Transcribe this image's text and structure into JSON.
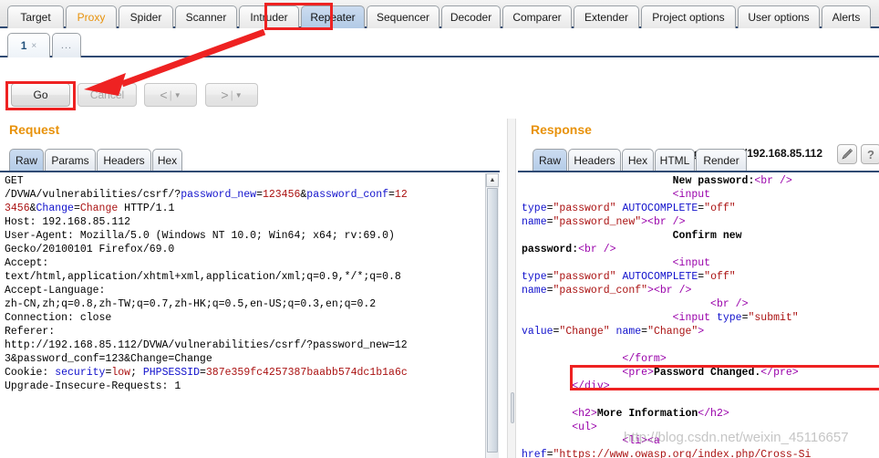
{
  "main_tabs": [
    {
      "label": "Target",
      "selected": false,
      "highlight": false
    },
    {
      "label": "Proxy",
      "selected": false,
      "highlight": true
    },
    {
      "label": "Spider",
      "selected": false,
      "highlight": false
    },
    {
      "label": "Scanner",
      "selected": false,
      "highlight": false
    },
    {
      "label": "Intruder",
      "selected": false,
      "highlight": false
    },
    {
      "label": "Repeater",
      "selected": true,
      "highlight": false
    },
    {
      "label": "Sequencer",
      "selected": false,
      "highlight": false
    },
    {
      "label": "Decoder",
      "selected": false,
      "highlight": false
    },
    {
      "label": "Comparer",
      "selected": false,
      "highlight": false
    },
    {
      "label": "Extender",
      "selected": false,
      "highlight": false
    },
    {
      "label": "Project options",
      "selected": false,
      "highlight": false
    },
    {
      "label": "User options",
      "selected": false,
      "highlight": false
    },
    {
      "label": "Alerts",
      "selected": false,
      "highlight": false
    }
  ],
  "repeater_tabs": {
    "tab_number": "1",
    "close_glyph": "×",
    "add_tab_label": "..."
  },
  "toolbar": {
    "go_label": "Go",
    "cancel_label": "Cancel",
    "back_glyph": "<",
    "forward_glyph": ">",
    "separator": "|",
    "caret_glyph": "▼",
    "target_label": "Target: http://192.168.85.112",
    "edit_icon_name": "pencil-icon",
    "help_icon_name": "question-mark-icon",
    "help_glyph": "?"
  },
  "request": {
    "title": "Request",
    "tabs": [
      "Raw",
      "Params",
      "Headers",
      "Hex"
    ],
    "selected_tab": "Raw",
    "lines": [
      [
        {
          "t": "GET",
          "c": ""
        }
      ],
      [
        {
          "t": "/DVWA/vulnerabilities/csrf/?",
          "c": ""
        },
        {
          "t": "password_new",
          "c": "kw-blue"
        },
        {
          "t": "=",
          "c": ""
        },
        {
          "t": "123456",
          "c": "kw-red"
        },
        {
          "t": "&",
          "c": ""
        },
        {
          "t": "password_conf",
          "c": "kw-blue"
        },
        {
          "t": "=",
          "c": ""
        },
        {
          "t": "12",
          "c": "kw-red"
        }
      ],
      [
        {
          "t": "3456",
          "c": "kw-red"
        },
        {
          "t": "&",
          "c": ""
        },
        {
          "t": "Change",
          "c": "kw-blue"
        },
        {
          "t": "=",
          "c": ""
        },
        {
          "t": "Change",
          "c": "kw-red"
        },
        {
          "t": " HTTP/1.1",
          "c": ""
        }
      ],
      [
        {
          "t": "Host: 192.168.85.112",
          "c": ""
        }
      ],
      [
        {
          "t": "User-Agent: Mozilla/5.0 (Windows NT 10.0; Win64; x64; rv:69.0)",
          "c": ""
        }
      ],
      [
        {
          "t": "Gecko/20100101 Firefox/69.0",
          "c": ""
        }
      ],
      [
        {
          "t": "Accept:",
          "c": ""
        }
      ],
      [
        {
          "t": "text/html,application/xhtml+xml,application/xml;q=0.9,*/*;q=0.8",
          "c": ""
        }
      ],
      [
        {
          "t": "Accept-Language:",
          "c": ""
        }
      ],
      [
        {
          "t": "zh-CN,zh;q=0.8,zh-TW;q=0.7,zh-HK;q=0.5,en-US;q=0.3,en;q=0.2",
          "c": ""
        }
      ],
      [
        {
          "t": "Connection: close",
          "c": ""
        }
      ],
      [
        {
          "t": "Referer:",
          "c": ""
        }
      ],
      [
        {
          "t": "http://192.168.85.112/DVWA/vulnerabilities/csrf/?password_new=12",
          "c": ""
        }
      ],
      [
        {
          "t": "3&password_conf=123&Change=Change",
          "c": ""
        }
      ],
      [
        {
          "t": "Cookie: ",
          "c": ""
        },
        {
          "t": "security",
          "c": "kw-blue"
        },
        {
          "t": "=",
          "c": ""
        },
        {
          "t": "low",
          "c": "kw-red"
        },
        {
          "t": "; ",
          "c": ""
        },
        {
          "t": "PHPSESSID",
          "c": "kw-blue"
        },
        {
          "t": "=",
          "c": ""
        },
        {
          "t": "387e359fc4257387baabb574dc1b1a6c",
          "c": "kw-red"
        }
      ],
      [
        {
          "t": "Upgrade-Insecure-Requests: 1",
          "c": ""
        }
      ]
    ]
  },
  "response": {
    "title": "Response",
    "tabs": [
      "Raw",
      "Headers",
      "Hex",
      "HTML",
      "Render"
    ],
    "selected_tab": "Raw",
    "lines": [
      [
        {
          "t": "                        ",
          "c": ""
        },
        {
          "t": "New password:",
          "c": "kw-bold"
        },
        {
          "t": "<br",
          "c": "kw-purple"
        },
        {
          "t": " ",
          "c": ""
        },
        {
          "t": "/>",
          "c": "kw-purple"
        }
      ],
      [
        {
          "t": "                        ",
          "c": ""
        },
        {
          "t": "<input",
          "c": "kw-purple"
        }
      ],
      [
        {
          "t": "type",
          "c": "kw-blue"
        },
        {
          "t": "=",
          "c": ""
        },
        {
          "t": "\"password\"",
          "c": "kw-red"
        },
        {
          "t": " ",
          "c": ""
        },
        {
          "t": "AUTOCOMPLETE",
          "c": "kw-blue"
        },
        {
          "t": "=",
          "c": ""
        },
        {
          "t": "\"off\"",
          "c": "kw-red"
        }
      ],
      [
        {
          "t": "name",
          "c": "kw-blue"
        },
        {
          "t": "=",
          "c": ""
        },
        {
          "t": "\"password_new\"",
          "c": "kw-red"
        },
        {
          "t": ">",
          "c": "kw-purple"
        },
        {
          "t": "<br",
          "c": "kw-purple"
        },
        {
          "t": " ",
          "c": ""
        },
        {
          "t": "/>",
          "c": "kw-purple"
        }
      ],
      [
        {
          "t": "                        ",
          "c": ""
        },
        {
          "t": "Confirm new",
          "c": "kw-bold"
        }
      ],
      [
        {
          "t": "password:",
          "c": "kw-bold"
        },
        {
          "t": "<br",
          "c": "kw-purple"
        },
        {
          "t": " ",
          "c": ""
        },
        {
          "t": "/>",
          "c": "kw-purple"
        }
      ],
      [
        {
          "t": "                        ",
          "c": ""
        },
        {
          "t": "<input",
          "c": "kw-purple"
        }
      ],
      [
        {
          "t": "type",
          "c": "kw-blue"
        },
        {
          "t": "=",
          "c": ""
        },
        {
          "t": "\"password\"",
          "c": "kw-red"
        },
        {
          "t": " ",
          "c": ""
        },
        {
          "t": "AUTOCOMPLETE",
          "c": "kw-blue"
        },
        {
          "t": "=",
          "c": ""
        },
        {
          "t": "\"off\"",
          "c": "kw-red"
        }
      ],
      [
        {
          "t": "name",
          "c": "kw-blue"
        },
        {
          "t": "=",
          "c": ""
        },
        {
          "t": "\"password_conf\"",
          "c": "kw-red"
        },
        {
          "t": ">",
          "c": "kw-purple"
        },
        {
          "t": "<br",
          "c": "kw-purple"
        },
        {
          "t": " ",
          "c": ""
        },
        {
          "t": "/>",
          "c": "kw-purple"
        }
      ],
      [
        {
          "t": "                              ",
          "c": ""
        },
        {
          "t": "<br",
          "c": "kw-purple"
        },
        {
          "t": " ",
          "c": ""
        },
        {
          "t": "/>",
          "c": "kw-purple"
        }
      ],
      [
        {
          "t": "                        ",
          "c": ""
        },
        {
          "t": "<input",
          "c": "kw-purple"
        },
        {
          "t": " ",
          "c": ""
        },
        {
          "t": "type",
          "c": "kw-blue"
        },
        {
          "t": "=",
          "c": ""
        },
        {
          "t": "\"submit\"",
          "c": "kw-red"
        }
      ],
      [
        {
          "t": "value",
          "c": "kw-blue"
        },
        {
          "t": "=",
          "c": ""
        },
        {
          "t": "\"Change\"",
          "c": "kw-red"
        },
        {
          "t": " ",
          "c": ""
        },
        {
          "t": "name",
          "c": "kw-blue"
        },
        {
          "t": "=",
          "c": ""
        },
        {
          "t": "\"Change\"",
          "c": "kw-red"
        },
        {
          "t": ">",
          "c": "kw-purple"
        }
      ],
      [
        {
          "t": "",
          "c": ""
        }
      ],
      [
        {
          "t": "                ",
          "c": ""
        },
        {
          "t": "</form>",
          "c": "kw-purple"
        }
      ],
      [
        {
          "t": "                ",
          "c": ""
        },
        {
          "t": "<pre>",
          "c": "kw-purple"
        },
        {
          "t": "Password Changed.",
          "c": "kw-bold"
        },
        {
          "t": "</pre>",
          "c": "kw-purple"
        }
      ],
      [
        {
          "t": "        ",
          "c": ""
        },
        {
          "t": "</div>",
          "c": "kw-purple"
        }
      ],
      [
        {
          "t": "",
          "c": ""
        }
      ],
      [
        {
          "t": "        ",
          "c": ""
        },
        {
          "t": "<h2>",
          "c": "kw-purple"
        },
        {
          "t": "More Information",
          "c": "kw-bold"
        },
        {
          "t": "</h2>",
          "c": "kw-purple"
        }
      ],
      [
        {
          "t": "        ",
          "c": ""
        },
        {
          "t": "<ul>",
          "c": "kw-purple"
        }
      ],
      [
        {
          "t": "                ",
          "c": ""
        },
        {
          "t": "<li><a",
          "c": "kw-purple"
        }
      ],
      [
        {
          "t": "href",
          "c": "kw-blue"
        },
        {
          "t": "=",
          "c": ""
        },
        {
          "t": "\"https://www.owasp.org/index.php/Cross-Si",
          "c": "kw-red"
        }
      ]
    ]
  },
  "annotations": {
    "watermark": "http://blog.csdn.net/weixin_45116657",
    "highlight_color": "#ee2222",
    "accent_color": "#e8920b",
    "selected_tab_color": "#bdd2ea"
  }
}
